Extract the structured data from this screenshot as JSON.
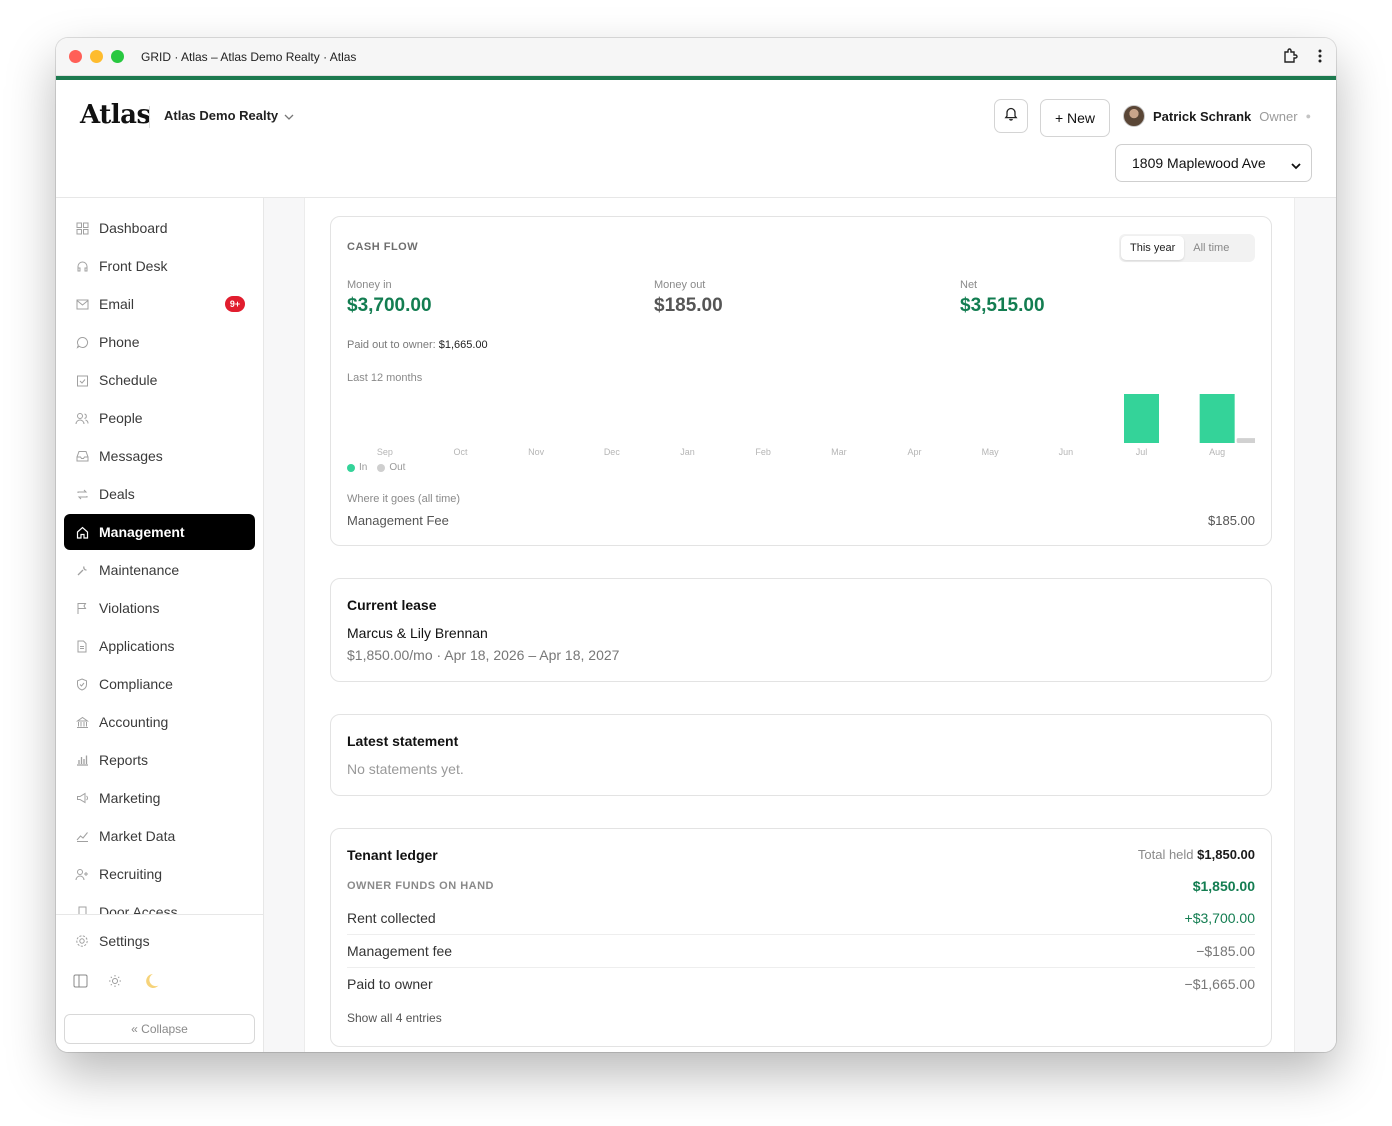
{
  "window": {
    "title": "GRID · Atlas – Atlas Demo Realty · Atlas"
  },
  "header": {
    "logo": "Atlas",
    "org": "Atlas Demo Realty",
    "new_label": "+ New",
    "user_name": "Patrick Schrank",
    "user_role": "Owner",
    "property": "1809 Maplewood Ave"
  },
  "sidebar": {
    "items": [
      {
        "label": "Dashboard",
        "icon": "grid-icon"
      },
      {
        "label": "Front Desk",
        "icon": "headset-icon"
      },
      {
        "label": "Email",
        "icon": "mail-icon",
        "badge": "9+"
      },
      {
        "label": "Phone",
        "icon": "chat-icon"
      },
      {
        "label": "Schedule",
        "icon": "calendar-check-icon"
      },
      {
        "label": "People",
        "icon": "people-icon"
      },
      {
        "label": "Messages",
        "icon": "inbox-icon"
      },
      {
        "label": "Deals",
        "icon": "repeat-icon"
      },
      {
        "label": "Management",
        "icon": "home-icon",
        "active": true
      },
      {
        "label": "Maintenance",
        "icon": "wrench-icon"
      },
      {
        "label": "Violations",
        "icon": "flag-icon"
      },
      {
        "label": "Applications",
        "icon": "document-icon"
      },
      {
        "label": "Compliance",
        "icon": "shield-icon"
      },
      {
        "label": "Accounting",
        "icon": "bank-icon"
      },
      {
        "label": "Reports",
        "icon": "bar-chart-icon"
      },
      {
        "label": "Marketing",
        "icon": "megaphone-icon"
      },
      {
        "label": "Market Data",
        "icon": "trend-icon"
      },
      {
        "label": "Recruiting",
        "icon": "user-plus-icon"
      },
      {
        "label": "Door Access",
        "icon": "door-icon"
      }
    ],
    "settings_label": "Settings",
    "collapse_label": "« Collapse"
  },
  "cashflow": {
    "title": "CASH FLOW",
    "toggle": [
      "This year",
      "All time"
    ],
    "selected_toggle": "This year",
    "money_in_label": "Money in",
    "money_in": "$3,700.00",
    "money_out_label": "Money out",
    "money_out": "$185.00",
    "net_label": "Net",
    "net": "$3,515.00",
    "paid_out_label": "Paid out to owner:",
    "paid_out": "$1,665.00",
    "period_label": "Last 12 months",
    "legend_in": "In",
    "legend_out": "Out",
    "where_label": "Where it goes (all time)",
    "where_item": "Management Fee",
    "where_amount": "$185.00"
  },
  "chart_data": {
    "type": "bar",
    "categories": [
      "Sep",
      "Oct",
      "Nov",
      "Dec",
      "Jan",
      "Feb",
      "Mar",
      "Apr",
      "May",
      "Jun",
      "Jul",
      "Aug"
    ],
    "series": [
      {
        "name": "In",
        "values": [
          0,
          0,
          0,
          0,
          0,
          0,
          0,
          0,
          0,
          0,
          1850,
          1850
        ]
      },
      {
        "name": "Out",
        "values": [
          0,
          0,
          0,
          0,
          0,
          0,
          0,
          0,
          0,
          0,
          0,
          185
        ]
      }
    ],
    "colors": {
      "in": "#34d399",
      "out": "#d1d1d1"
    },
    "ylim": [
      0,
      1850
    ],
    "grid": false,
    "legend": "bottom-left"
  },
  "lease": {
    "title": "Current lease",
    "tenants": "Marcus & Lily Brennan",
    "details": "$1,850.00/mo · Apr 18, 2026 – Apr 18, 2027"
  },
  "statement": {
    "title": "Latest statement",
    "empty": "No statements yet."
  },
  "ledger": {
    "title": "Tenant ledger",
    "total_held_label": "Total held",
    "total_held": "$1,850.00",
    "funds_label": "OWNER FUNDS ON HAND",
    "funds": "$1,850.00",
    "rows": [
      {
        "label": "Rent collected",
        "amount": "+$3,700.00",
        "positive": true
      },
      {
        "label": "Management fee",
        "amount": "−$185.00",
        "positive": false
      },
      {
        "label": "Paid to owner",
        "amount": "−$1,665.00",
        "positive": false
      }
    ],
    "show_all": "Show all 4 entries"
  },
  "colors": {
    "accent": "#1d7a4f",
    "money_green": "#137d51",
    "bar_in": "#34d399",
    "badge_red": "#e11d2e"
  }
}
